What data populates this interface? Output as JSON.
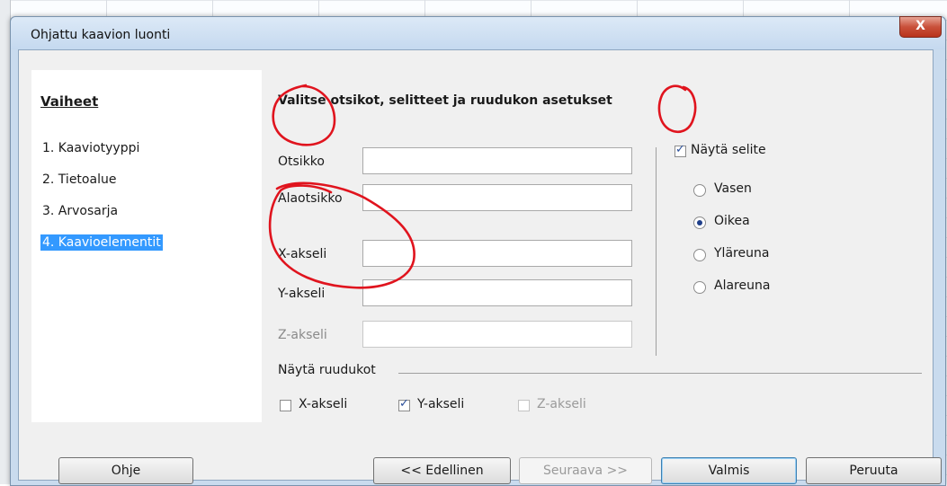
{
  "window": {
    "title": "Ohjattu kaavion luonti",
    "close_glyph": "X"
  },
  "steps": {
    "title": "Vaiheet",
    "items": [
      {
        "label": "1. Kaaviotyyppi",
        "active": false
      },
      {
        "label": "2. Tietoalue",
        "active": false
      },
      {
        "label": "3. Arvosarja",
        "active": false
      },
      {
        "label": "4. Kaavioelementit",
        "active": true
      }
    ]
  },
  "main": {
    "heading": "Valitse otsikot, selitteet ja ruudukon asetukset",
    "fields": [
      {
        "label": "Otsikko",
        "value": "",
        "enabled": true
      },
      {
        "label": "Alaotsikko",
        "value": "",
        "enabled": true
      },
      {
        "label": "X-akseli",
        "value": "",
        "enabled": true
      },
      {
        "label": "Y-akseli",
        "value": "",
        "enabled": true
      },
      {
        "label": "Z-akseli",
        "value": "",
        "enabled": false
      }
    ]
  },
  "legend": {
    "show_label": "Näytä selite",
    "show_checked": true,
    "options": [
      {
        "label": "Vasen",
        "selected": false
      },
      {
        "label": "Oikea",
        "selected": true
      },
      {
        "label": "Yläreuna",
        "selected": false
      },
      {
        "label": "Alareuna",
        "selected": false
      }
    ]
  },
  "grid": {
    "title": "Näytä ruudukot",
    "x": {
      "label": "X-akseli",
      "checked": false,
      "enabled": true
    },
    "y": {
      "label": "Y-akseli",
      "checked": true,
      "enabled": true
    },
    "z": {
      "label": "Z-akseli",
      "checked": false,
      "enabled": false
    }
  },
  "buttons": {
    "help": "Ohje",
    "back": "<< Edellinen",
    "next": "Seuraava >>",
    "finish": "Valmis",
    "cancel": "Peruuta"
  },
  "colors": {
    "selection": "#3399ff",
    "annotation": "#e0141e",
    "panel": "#f0f0f0"
  }
}
